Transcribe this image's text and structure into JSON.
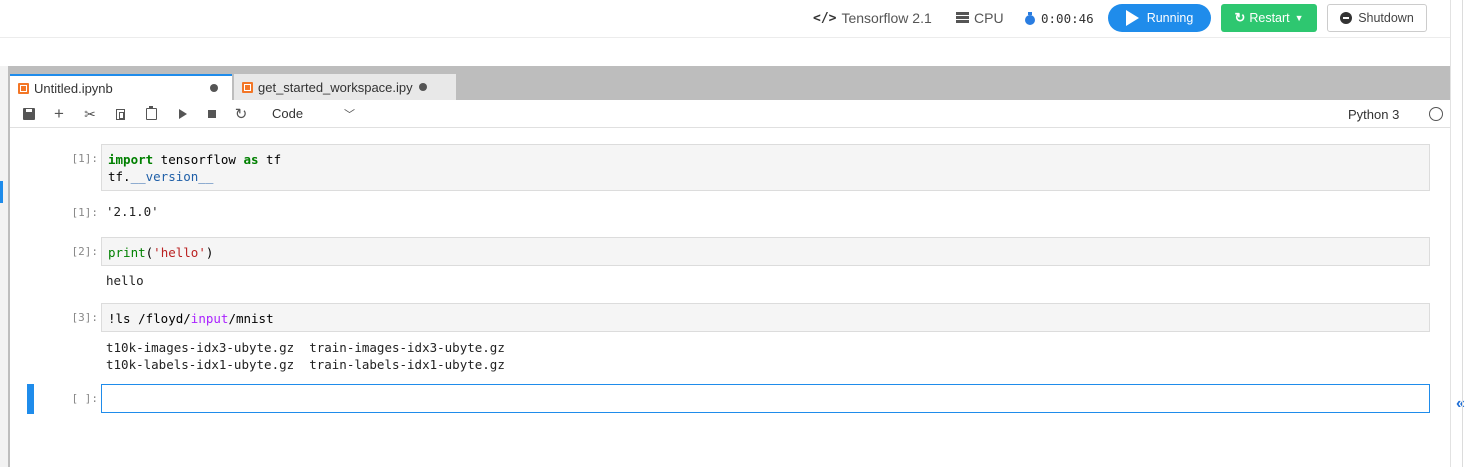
{
  "header": {
    "environment": "Tensorflow 2.1",
    "machine": "CPU",
    "elapsed": "0:00:46",
    "running_label": "Running",
    "restart_label": "Restart",
    "shutdown_label": "Shutdown",
    "colors": {
      "running": "#1f8ceb",
      "restart": "#2ec770"
    }
  },
  "tabs": [
    {
      "label": "Untitled.ipynb",
      "icon": "notebook-icon",
      "active": true
    },
    {
      "label": "get_started_workspace.ipy",
      "icon": "notebook-icon",
      "active": false
    }
  ],
  "toolbar": {
    "icons": [
      "save-icon",
      "add-icon",
      "cut-icon",
      "copy-icon",
      "paste-icon",
      "run-icon",
      "stop-icon",
      "restart-icon"
    ],
    "cell_type": "Code",
    "kernel": "Python 3"
  },
  "cells": [
    {
      "prompt": "[1]:",
      "input_line1_kw": "import",
      "input_line1_mid": " tensorflow ",
      "input_line1_kw2": "as",
      "input_line1_end": " tf",
      "input_line2_pre": "tf.",
      "input_line2_attr": "__version__",
      "output_prompt": "[1]:",
      "output": "'2.1.0'"
    },
    {
      "prompt": "[2]:",
      "input_fn": "print",
      "input_paren_open": "(",
      "input_str": "'hello'",
      "input_paren_close": ")",
      "output": "hello"
    },
    {
      "prompt": "[3]:",
      "input_pre": "!ls /floyd/",
      "input_kw": "input",
      "input_post": "/mnist",
      "output_line1": "t10k-images-idx3-ubyte.gz  train-images-idx3-ubyte.gz",
      "output_line2": "t10k-labels-idx1-ubyte.gz  train-labels-idx1-ubyte.gz"
    },
    {
      "prompt": "[ ]:"
    }
  ],
  "sidebar": {
    "collapse_glyph": "«"
  }
}
